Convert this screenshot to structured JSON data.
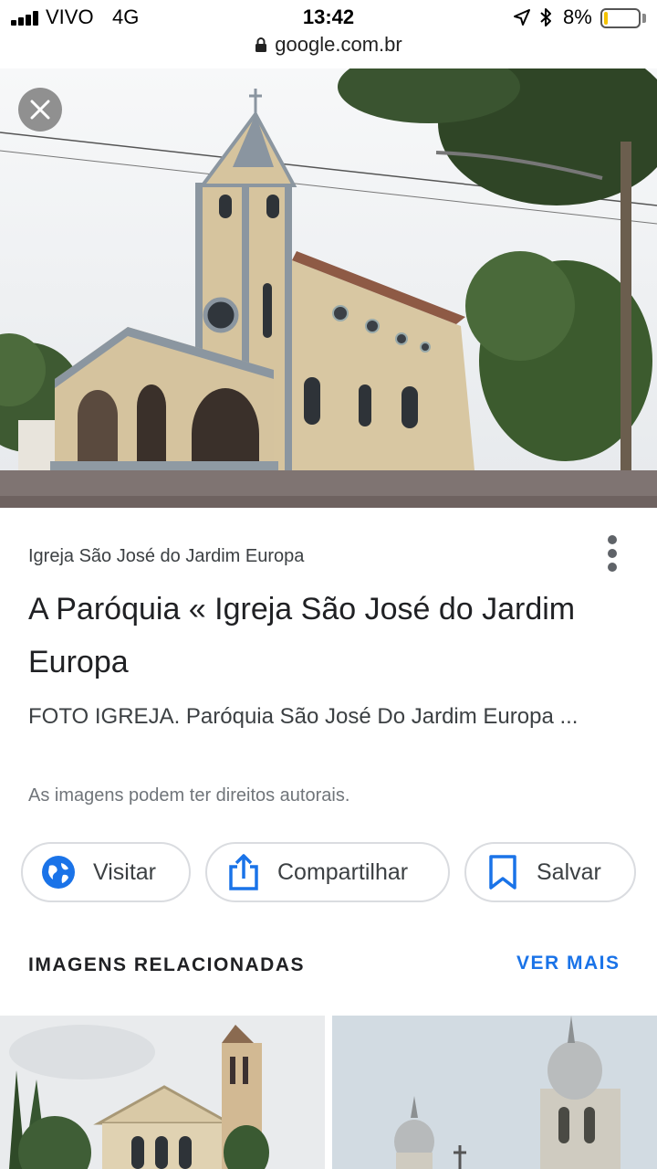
{
  "status_bar": {
    "carrier": "VIVO",
    "network": "4G",
    "time": "13:42",
    "battery_percent": "8%",
    "battery_level": 0.08,
    "battery_color": "#f4c300"
  },
  "url_bar": {
    "url": "google.com.br",
    "icon": "lock-icon"
  },
  "image_result": {
    "source": "Igreja São José do Jardim Europa",
    "title": "A Paróquia « Igreja São José do Jardim Europa",
    "snippet": "FOTO IGREJA. Paróquia São José Do Jardim Europa ...",
    "copyright_notice": "As imagens podem ter direitos autorais.",
    "close_icon": "close-icon",
    "more_icon": "more-vertical-icon"
  },
  "actions": {
    "visit_label": "Visitar",
    "share_label": "Compartilhar",
    "save_label": "Salvar",
    "visit_icon": "globe-icon",
    "share_icon": "share-icon",
    "save_icon": "bookmark-icon"
  },
  "related": {
    "heading": "IMAGENS RELACIONADAS",
    "see_more": "VER MAIS",
    "accent_color": "#1a73e8"
  }
}
